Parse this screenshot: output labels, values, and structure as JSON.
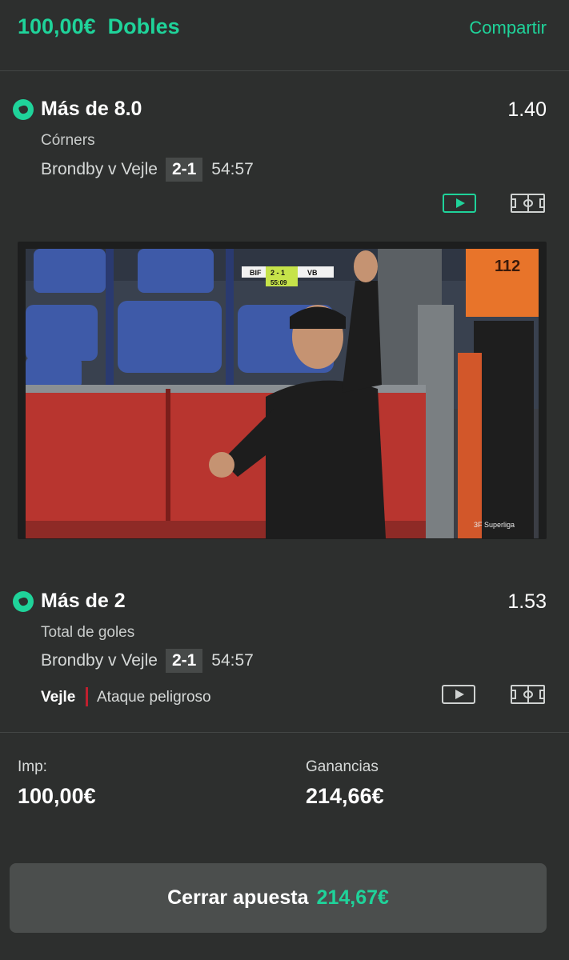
{
  "header": {
    "title": "100,00€  Dobles",
    "share_label": "Compartir"
  },
  "selections": [
    {
      "title": "Más de 8.0",
      "odds": "1.40",
      "market": "Córners",
      "match": "Brondby v Vejle",
      "score": "2-1",
      "clock": "54:57"
    },
    {
      "title": "Más de 2",
      "odds": "1.53",
      "market": "Total de goles",
      "match": "Brondby v Vejle",
      "score": "2-1",
      "clock": "54:57",
      "live": {
        "team": "Vejle",
        "event": "Ataque peligroso"
      }
    }
  ],
  "video": {
    "scoreboard": {
      "home": "BIF",
      "score": "2 - 1",
      "away": "VB",
      "time": "55:09"
    },
    "watermark": "3F Superliga",
    "board_number": "112"
  },
  "stake": {
    "stake_label": "Imp:",
    "stake_value": "100,00€",
    "returns_label": "Ganancias",
    "returns_value": "214,66€"
  },
  "cashout": {
    "label": "Cerrar apuesta",
    "value": "214,67€"
  },
  "colors": {
    "accent": "#1fd39a",
    "background": "#2d2f2e",
    "live_bar": "#c0202e"
  }
}
